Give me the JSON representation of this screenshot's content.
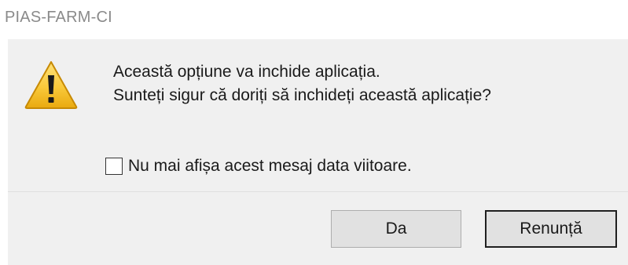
{
  "window": {
    "title": "PIAS-FARM-CI"
  },
  "dialog": {
    "icon": "warning-icon",
    "message_line1": "Această opțiune va inchide aplicația.",
    "message_line2": "Sunteți sigur că doriți să inchideți această aplicație?",
    "checkbox": {
      "label": "Nu mai afișa acest mesaj data viitoare.",
      "checked": false
    }
  },
  "buttons": {
    "yes_label": "Da",
    "cancel_label": "Renunță"
  },
  "colors": {
    "dialog_background": "#f0f0f0",
    "button_background": "#e1e1e1",
    "warning_yellow": "#f7c531",
    "title_text": "#8a8a8a"
  }
}
